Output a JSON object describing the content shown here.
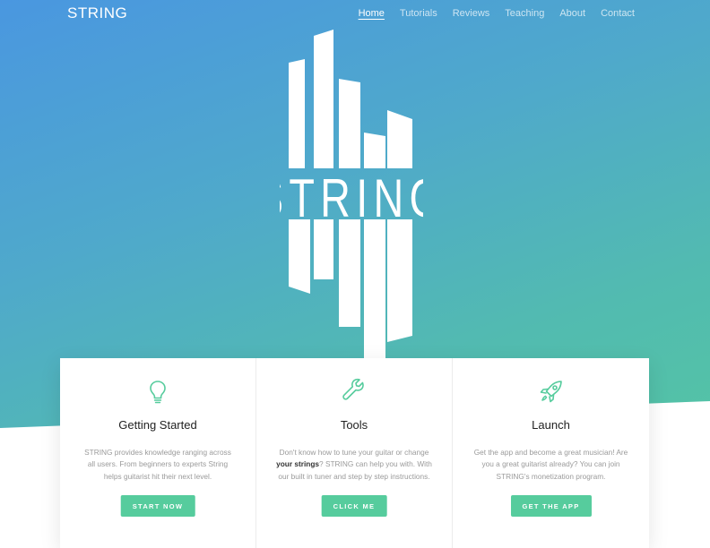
{
  "brand": "STRING",
  "nav": [
    {
      "label": "Home",
      "active": true
    },
    {
      "label": "Tutorials"
    },
    {
      "label": "Reviews"
    },
    {
      "label": "Teaching"
    },
    {
      "label": "About"
    },
    {
      "label": "Contact"
    }
  ],
  "hero": {
    "logo_text": "STRING",
    "gradient_colors": [
      "#4a97e0",
      "#55c99e"
    ]
  },
  "cards": [
    {
      "icon": "lightbulb-icon",
      "title": "Getting Started",
      "text": "STRING provides knowledge ranging across all users. From beginners to experts String helps guitarist hit their next level.",
      "button": "START NOW"
    },
    {
      "icon": "wrench-icon",
      "title": "Tools",
      "text_before": "Don't know how to tune your guitar or change ",
      "text_bold": "your strings",
      "text_after": "? STRING can help you with. With our built in tuner and step by step instructions.",
      "button": "CLICK ME"
    },
    {
      "icon": "rocket-icon",
      "title": "Launch",
      "text": "Get the app and become a great musician! Are you a great guitarist already? You can join STRING's monetization program.",
      "button": "GET THE APP"
    }
  ],
  "colors": {
    "accent": "#56cc9d",
    "icon": "#56cc9d"
  }
}
